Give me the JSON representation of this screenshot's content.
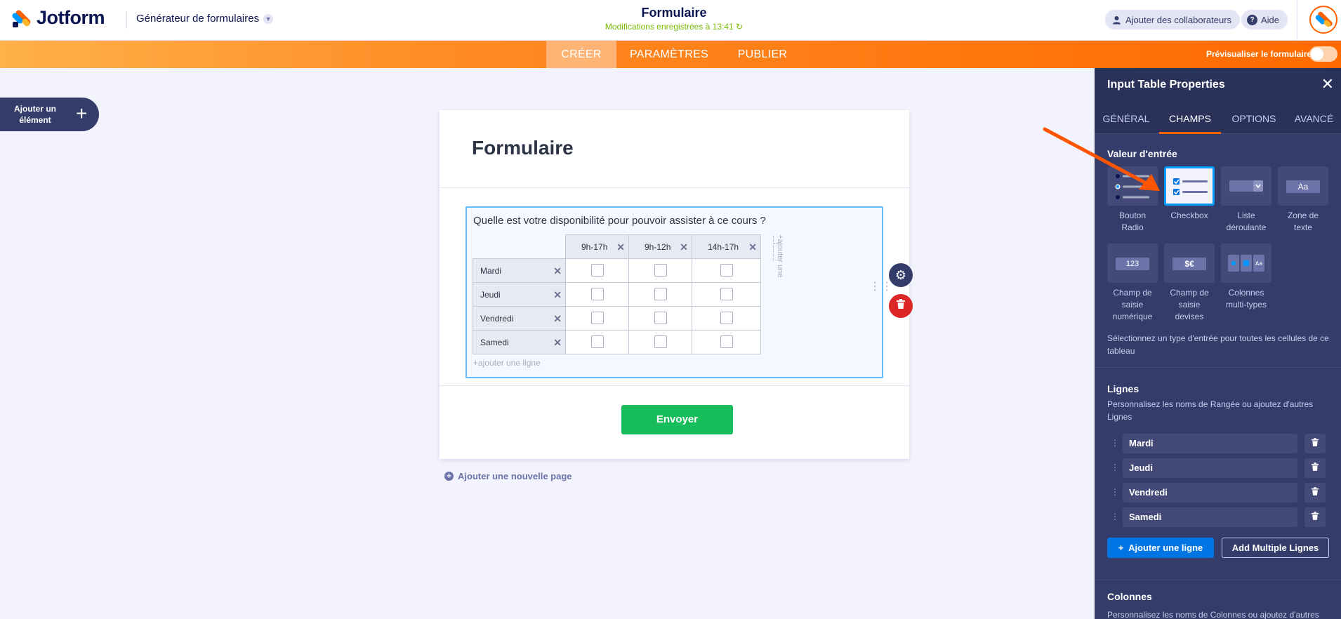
{
  "header": {
    "logo_text": "Jotform",
    "builder_label": "Générateur de formulaires",
    "form_title": "Formulaire",
    "save_status": "Modifications enregistrées à 13:41",
    "collab_label": "Ajouter des collaborateurs",
    "help_label": "Aide"
  },
  "nav": {
    "tabs": [
      {
        "label": "CRÉER"
      },
      {
        "label": "PARAMÈTRES"
      },
      {
        "label": "PUBLIER"
      }
    ],
    "preview_label": "Prévisualiser le formulaire"
  },
  "add_element": {
    "label": "Ajouter un élément",
    "icon": "plus-icon"
  },
  "form": {
    "title": "Formulaire",
    "question": "Quelle est votre disponibilité pour pouvoir assister à ce cours ?",
    "columns": [
      "9h-17h",
      "9h-12h",
      "14h-17h"
    ],
    "rows": [
      "Mardi",
      "Jeudi",
      "Vendredi",
      "Samedi"
    ],
    "add_column": "+ajouter une colonne",
    "add_row": "+ajouter une ligne",
    "submit_label": "Envoyer",
    "add_page": "Ajouter une nouvelle page"
  },
  "panel": {
    "title": "Input Table Properties",
    "tabs": [
      "GÉNÉRAL",
      "CHAMPS",
      "OPTIONS",
      "AVANCÉ"
    ],
    "input_section_title": "Valeur d'entrée",
    "input_options": [
      {
        "label": "Bouton Radio",
        "icon": "radio-list-icon"
      },
      {
        "label": "Checkbox",
        "icon": "checkbox-list-icon",
        "selected": true
      },
      {
        "label": "Liste déroulante",
        "icon": "dropdown-icon"
      },
      {
        "label": "Zone de texte",
        "icon": "text-field-icon",
        "glyph": "Aa"
      },
      {
        "label": "Champ de saisie numérique",
        "icon": "number-field-icon",
        "glyph": "123"
      },
      {
        "label": "Champ de saisie devises",
        "icon": "currency-field-icon",
        "glyph": "$€"
      },
      {
        "label": "Colonnes multi-types",
        "icon": "multi-type-icon"
      }
    ],
    "input_desc": "Sélectionnez un type d'entrée pour toutes les cellules de ce tableau",
    "rows_title": "Lignes",
    "rows_desc": "Personnalisez les noms de Rangée ou ajoutez d'autres Lignes",
    "row_values": [
      "Mardi",
      "Jeudi",
      "Vendredi",
      "Samedi"
    ],
    "add_row_btn": "Ajouter une ligne",
    "add_multiple_btn": "Add Multiple Lignes",
    "cols_title": "Colonnes",
    "cols_desc": "Personnalisez les noms de Colonnes ou ajoutez d'autres"
  },
  "colors": {
    "brand_orange": "#ff6100",
    "panel_bg": "#343c6a",
    "submit_green": "#18bd5b",
    "accent_blue": "#0099ff"
  }
}
